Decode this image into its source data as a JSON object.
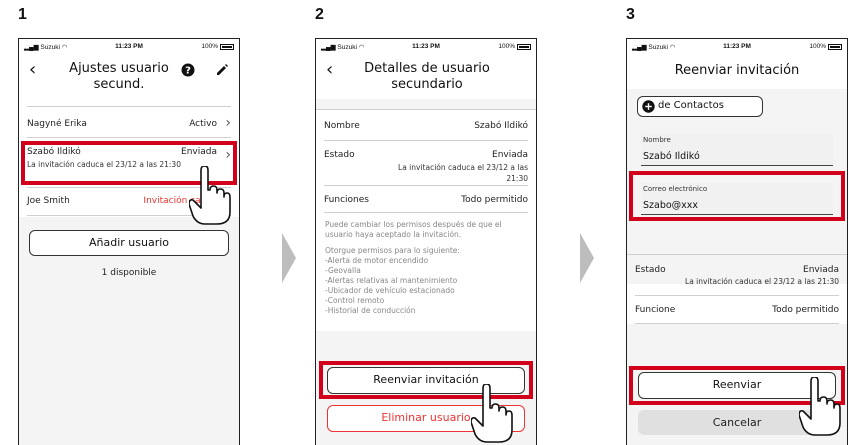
{
  "steps": [
    "1",
    "2",
    "3"
  ],
  "status": {
    "carrier": "Suzuki",
    "time": "11:23 PM",
    "battery": "100%"
  },
  "screen1": {
    "title_line1": "Ajustes usuario",
    "title_line2": "secund.",
    "users": [
      {
        "name": "Nagyné Erika",
        "status": "Activo"
      },
      {
        "name": "Szabó Ildikó",
        "status": "Enviada",
        "note": "La invitación caduca el 23/12 a las 21:30"
      },
      {
        "name": "Joe Smith",
        "status": "Invitación caduc"
      }
    ],
    "add_button": "Añadir usuario",
    "available": "1 disponible"
  },
  "screen2": {
    "title_line1": "Detalles de usuario",
    "title_line2": "secundario",
    "name_label": "Nombre",
    "name_value": "Szabó Ildikó",
    "state_label": "Estado",
    "state_value": "Enviada",
    "state_note_1": "La invitación caduca el 23/12 a las",
    "state_note_2": "21:30",
    "functions_label": "Funciones",
    "functions_value": "Todo permitido",
    "info_1": "Puede cambiar los permisos después de que el usuario haya aceptado la invitación.",
    "info_2": "Otorgue permisos para lo siguiente:",
    "permissions": [
      "-Alerta de motor encendido",
      "-Geovalla",
      "-Alertas relativas al mantenimiento",
      "-Ubicador de vehículo estacionado",
      "-Control remoto",
      "-Historial de conducción"
    ],
    "resend_button": "Reenviar invitación",
    "delete_button": "Eliminar usuario"
  },
  "screen3": {
    "title": "Reenviar invitación",
    "contacts_button": "de Contactos",
    "name_label": "Nombre",
    "name_value": "Szabó Ildikó",
    "email_label": "Correo electrónico",
    "email_value": "Szabo@xxx",
    "state_label": "Estado",
    "state_value": "Enviada",
    "state_note": "La invitación caduca el 23/12 a las 21:30",
    "functions_label": "Funcione",
    "functions_value": "Todo permitido",
    "resend_button": "Reenviar",
    "cancel_button": "Cancelar"
  },
  "colors": {
    "highlight": "#d3001c",
    "danger": "#e33333",
    "chevron": "#bdbdbd"
  },
  "icons": [
    "signal-icon",
    "wifi-icon",
    "battery-icon",
    "back-icon",
    "help-icon",
    "edit-icon",
    "chevron-right-icon",
    "plus-circle-icon",
    "hand-pointer-icon",
    "step-arrow-icon"
  ]
}
